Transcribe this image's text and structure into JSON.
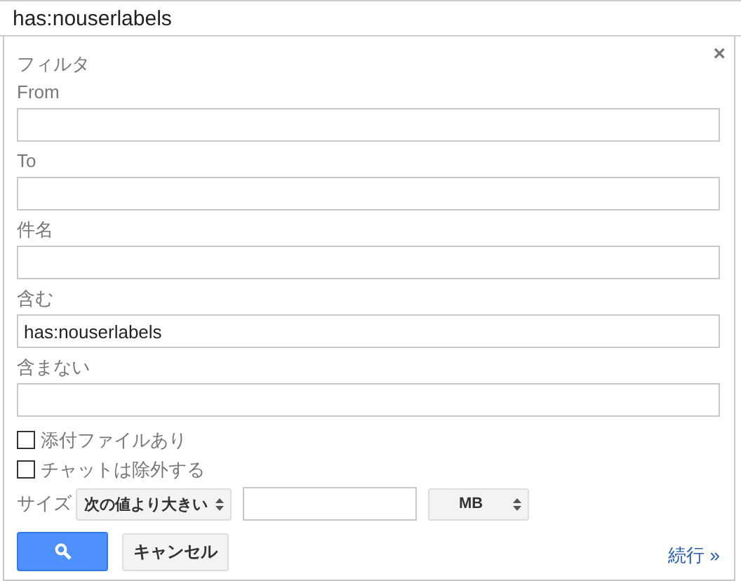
{
  "search_bar": {
    "value": "has:nouserlabels"
  },
  "panel": {
    "title": "フィルタ",
    "close": "×",
    "fields": [
      {
        "label": "From"
      },
      {
        "label": "To"
      },
      {
        "label": "件名"
      },
      {
        "label": "含む",
        "value": "has:nouserlabels"
      },
      {
        "label": "含まない"
      }
    ],
    "checkboxes": [
      {
        "label": "添付ファイルあり",
        "checked": false
      },
      {
        "label": "チャットは除外する",
        "checked": false
      }
    ],
    "size": {
      "label": "サイズ",
      "comparator": "次の値より大きい",
      "unit": "MB"
    },
    "cancel_button": "キャンセル",
    "continue_link": "続行 »"
  }
}
